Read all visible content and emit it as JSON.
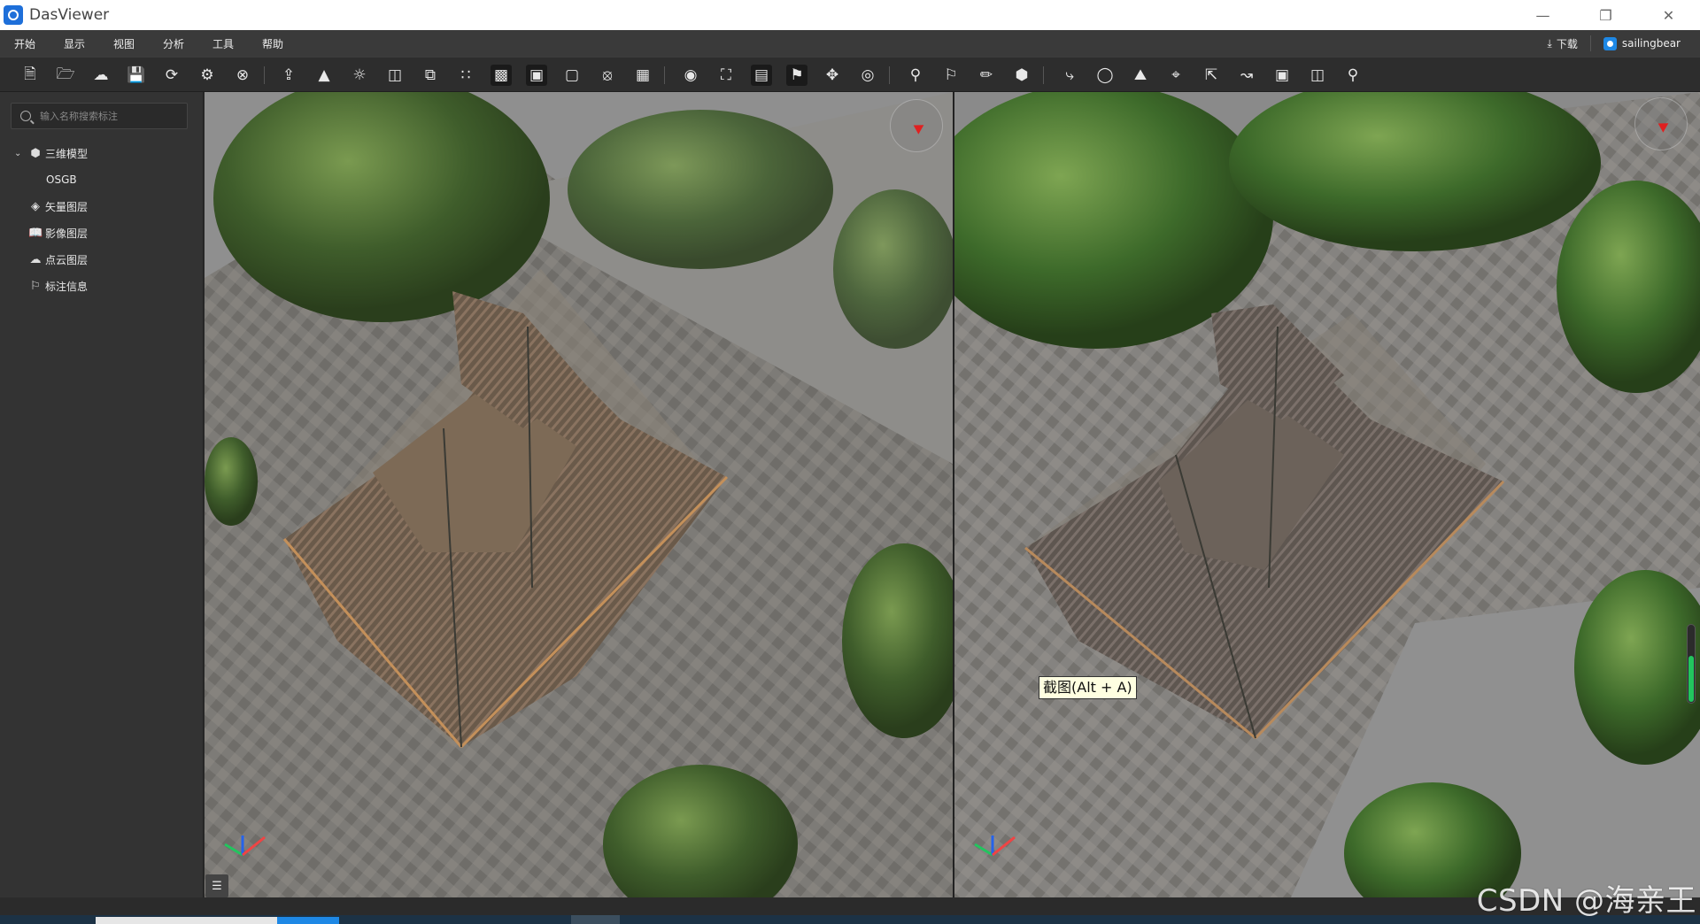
{
  "window": {
    "title": "DasViewer",
    "controls": [
      "minimize-icon",
      "restore-icon",
      "close-icon"
    ]
  },
  "menu": {
    "items": [
      "开始",
      "显示",
      "视图",
      "分析",
      "工具",
      "帮助"
    ],
    "download_label": "下载",
    "user_name": "sailingbear"
  },
  "toolbar": {
    "groups": [
      [
        "new-file-icon",
        "open-folder-icon",
        "cloud-icon",
        "save-icon",
        "refresh-icon",
        "settings-icon",
        "close-circle-icon"
      ],
      [
        "import-icon",
        "terrain-icon",
        "sun-icon",
        "split-view-icon",
        "layers-overlay-icon",
        "point-grid-icon",
        "box-layers-icon",
        "cube-solid-icon",
        "cube-outline-icon",
        "cube-x-icon",
        "grid-icon"
      ],
      [
        "eye-rotate-icon",
        "frame-icon",
        "monitor-icon",
        "flag-arrow-icon",
        "move-icon",
        "eye-lock-icon"
      ],
      [
        "location-pin-icon",
        "flag-icon",
        "ruler-icon",
        "cube-shaded-icon"
      ],
      [
        "route-icon",
        "camera-icon",
        "mountain-measure-icon",
        "crop-icon",
        "export-icon",
        "chart-icon",
        "image-icon",
        "building-icon",
        "search-icon"
      ]
    ]
  },
  "sidebar": {
    "search_placeholder": "输入名称搜索标注",
    "tree": [
      {
        "label": "三维模型",
        "icon": "cube-icon",
        "expanded": true
      },
      {
        "label": "OSGB",
        "icon": "",
        "child": true
      },
      {
        "label": "矢量图层",
        "icon": "layers-icon"
      },
      {
        "label": "影像图层",
        "icon": "book-icon"
      },
      {
        "label": "点云图层",
        "icon": "cloud-icon"
      },
      {
        "label": "标注信息",
        "icon": "flag-icon"
      }
    ]
  },
  "viewport": {
    "tooltip": "截图(Alt + A)",
    "slider_level": 0.6
  },
  "watermark": "CSDN @海亲王"
}
